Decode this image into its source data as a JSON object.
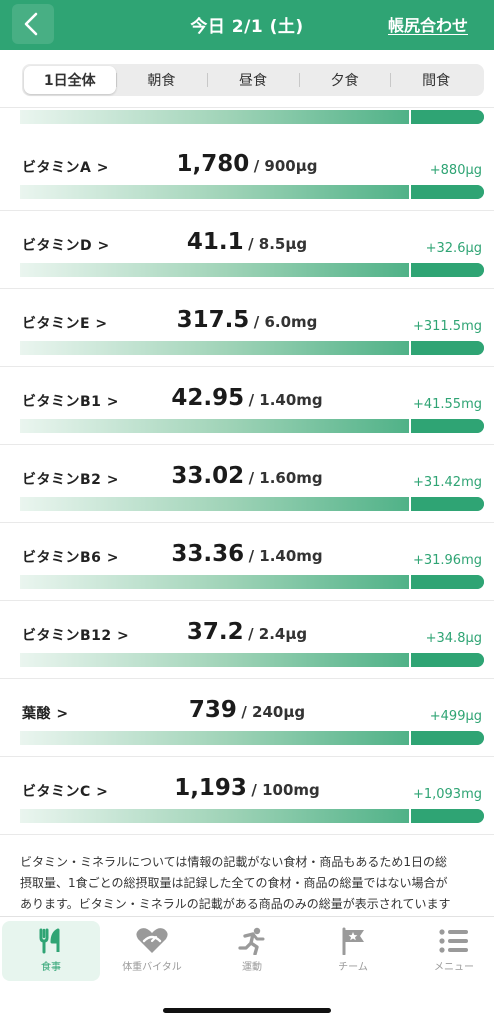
{
  "header": {
    "title": "今日 2/1 (土)",
    "link": "帳尻合わせ"
  },
  "tabs": [
    "1日全体",
    "朝食",
    "昼食",
    "夕食",
    "間食"
  ],
  "active_tab": "1日全体",
  "nutrients": [
    {
      "label": "ビタミンA >",
      "value": "1,780",
      "target": "/ 900μg",
      "diff": "+880μg"
    },
    {
      "label": "ビタミンD >",
      "value": "41.1",
      "target": "/ 8.5μg",
      "diff": "+32.6μg"
    },
    {
      "label": "ビタミンE >",
      "value": "317.5",
      "target": "/ 6.0mg",
      "diff": "+311.5mg"
    },
    {
      "label": "ビタミンB1 >",
      "value": "42.95",
      "target": "/ 1.40mg",
      "diff": "+41.55mg"
    },
    {
      "label": "ビタミンB2 >",
      "value": "33.02",
      "target": "/ 1.60mg",
      "diff": "+31.42mg"
    },
    {
      "label": "ビタミンB6 >",
      "value": "33.36",
      "target": "/ 1.40mg",
      "diff": "+31.96mg"
    },
    {
      "label": "ビタミンB12 >",
      "value": "37.2",
      "target": "/ 2.4μg",
      "diff": "+34.8μg"
    },
    {
      "label": "葉酸 >",
      "value": "739",
      "target": "/ 240μg",
      "diff": "+499μg"
    },
    {
      "label": "ビタミンC >",
      "value": "1,193",
      "target": "/ 100mg",
      "diff": "+1,093mg"
    }
  ],
  "note": {
    "line1": "ビタミン・ミネラルについては情報の記載がない食材・商品もあるため1日の総",
    "line2": "摂取量、1食ごとの総摂取量は記録した全ての食材・商品の総量ではない場合が",
    "line3": "あります。ビタミン・ミネラルの記載がある商品のみの総量が表示されています"
  },
  "nav": [
    {
      "label": "食事",
      "icon": "fork-knife-icon",
      "active": true
    },
    {
      "label": "体重バイタル",
      "icon": "heart-scale-icon",
      "active": false
    },
    {
      "label": "運動",
      "icon": "runner-icon",
      "active": false
    },
    {
      "label": "チーム",
      "icon": "flag-star-icon",
      "active": false
    },
    {
      "label": "メニュー",
      "icon": "menu-list-icon",
      "active": false
    }
  ],
  "colors": {
    "brand": "#2fa474",
    "diff_text": "#2fa474"
  }
}
